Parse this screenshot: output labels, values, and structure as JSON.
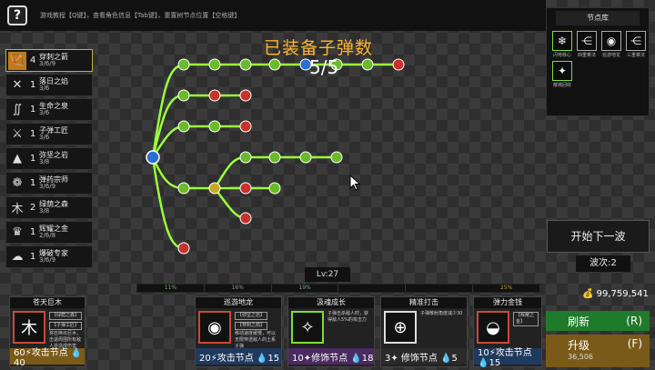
{
  "top_bar": {
    "help_label": "?",
    "tip": "游戏教程【Q键】，查看角色信息【Tab键】，重置树节点位置【空格键】"
  },
  "skills": [
    {
      "icon": "🏹",
      "level": "4",
      "name": "穿刺之箭",
      "frac": "3/6/9",
      "active": true
    },
    {
      "icon": "✕",
      "level": "1",
      "name": "落日之焰",
      "frac": "3/6",
      "active": false
    },
    {
      "icon": "∬",
      "level": "1",
      "name": "生命之泉",
      "frac": "3/6",
      "active": false
    },
    {
      "icon": "⚔",
      "level": "1",
      "name": "子弹工匠",
      "frac": "3/6",
      "active": false
    },
    {
      "icon": "▲",
      "level": "1",
      "name": "弥坚之岩",
      "frac": "3/8",
      "active": false
    },
    {
      "icon": "❁",
      "level": "1",
      "name": "弹药宗师",
      "frac": "3/6/9",
      "active": false
    },
    {
      "icon": "木",
      "level": "2",
      "name": "绿荫之森",
      "frac": "3/8",
      "active": false
    },
    {
      "icon": "♛",
      "level": "1",
      "name": "辉耀之金",
      "frac": "2/6/8",
      "active": false
    },
    {
      "icon": "☁",
      "level": "1",
      "name": "爆破专家",
      "frac": "3/6/9",
      "active": false
    }
  ],
  "ammo": {
    "title": "已装备子弹数",
    "count": "5/5"
  },
  "library": {
    "title": "节点库",
    "items": [
      {
        "icon": "❄",
        "label": "闪电核心",
        "green": true
      },
      {
        "icon": "⋲",
        "label": "四重乘法",
        "green": false
      },
      {
        "icon": "◉",
        "label": "巡游地龙",
        "green": false
      },
      {
        "icon": "⋲",
        "label": "三重乘法",
        "green": false
      },
      {
        "icon": "✦",
        "label": "散溅回收",
        "green": true
      }
    ]
  },
  "next_wave": {
    "label": "开始下一波",
    "wave_text": "波次:2"
  },
  "level": {
    "text": "Lv:27"
  },
  "xp_segments": [
    "11%",
    "16%",
    "19%",
    "",
    "",
    "25%"
  ],
  "cards": [
    {
      "title": "苍天巨木",
      "icon": "木",
      "icon_style": "red",
      "tags": [
        "【绿荫之森】",
        "【子弹工匠】"
      ],
      "desc": "将召唤出巨木，击退周围所有敌人并造成伤害",
      "cost": "60⚡攻击节点 💧40",
      "cost_style": "gold"
    },
    {
      "title": "巡游地龙",
      "icon": "◉",
      "icon_style": "red",
      "tags": [
        "【弥坚之岩】",
        "【穿刺之箭】"
      ],
      "desc": "移动速度缓慢，可以无限穿透敌人的土系子弹",
      "cost": "20⚡攻击节点 💧15",
      "cost_style": "blue"
    },
    {
      "title": "汲魂成长",
      "icon": "✧",
      "icon_style": "green",
      "tags": [],
      "desc": "子弹击杀敌人时，获得敌人5%的攻击力",
      "cost": "10✦修饰节点 💧18",
      "cost_style": "purple"
    },
    {
      "title": "精准打击",
      "icon": "⊕",
      "icon_style": "white",
      "tags": [],
      "desc": "子弹散射角度减少30",
      "cost": "3✦ 修饰节点 💧5",
      "cost_style": "dark"
    },
    {
      "title": "弹力金钱",
      "icon": "◒",
      "icon_style": "red",
      "tags": [
        "【辉耀之金】"
      ],
      "desc": "",
      "cost": "10⚡攻击节点 💧15",
      "cost_style": "blue"
    }
  ],
  "money": "99,759,541",
  "refresh": {
    "label": "刷新",
    "key": "(R)"
  },
  "upgrade": {
    "label": "升级",
    "key": "(F)",
    "sub": "36,506"
  }
}
